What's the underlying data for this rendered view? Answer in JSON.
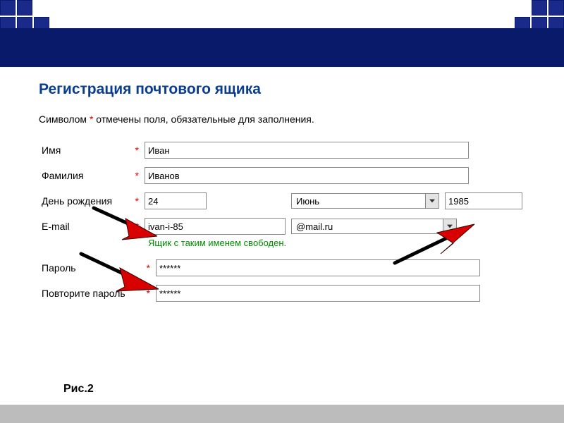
{
  "title": "Регистрация почтового ящика",
  "note_before": "Символом ",
  "note_after": " отмечены поля, обязательные для заполнения.",
  "asterisk": "*",
  "form": {
    "name_label": "Имя",
    "name_value": "Иван",
    "surname_label": "Фамилия",
    "surname_value": "Иванов",
    "dob_label": "День рождения",
    "dob_day": "24",
    "dob_month": "Июнь",
    "dob_year": "1985",
    "email_label": "E-mail",
    "email_user": "ivan-i-85",
    "email_domain": "@mail.ru",
    "email_hint": "Ящик с таким именем свободен.",
    "password_label": "Пароль",
    "password_value": "******",
    "password2_label": "Повторите пароль",
    "password2_value": "******"
  },
  "caption": "Рис.2"
}
